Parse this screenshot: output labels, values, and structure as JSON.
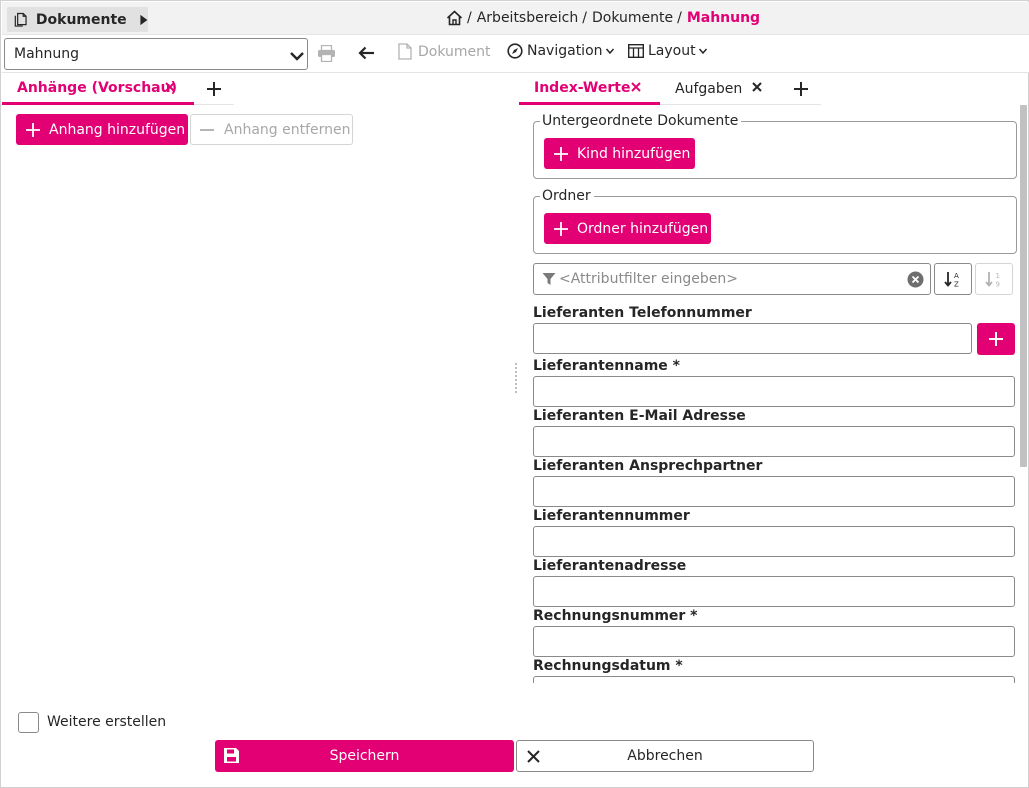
{
  "titlebar": {
    "module_label": "Dokumente",
    "breadcrumb": {
      "sep": "/",
      "items": [
        "Arbeitsbereich",
        "Dokumente"
      ],
      "current": "Mahnung"
    }
  },
  "toolbar": {
    "doctype_value": "Mahnung",
    "document_label": "Dokument",
    "navigation_label": "Navigation",
    "layout_label": "Layout"
  },
  "left_pane": {
    "tab_label": "Anhänge (Vorschau)",
    "add_attachment_label": "Anhang hinzufügen",
    "remove_attachment_label": "Anhang entfernen"
  },
  "right_pane": {
    "tabs": [
      {
        "label": "Index-Werte",
        "active": true
      },
      {
        "label": "Aufgaben",
        "active": false
      }
    ],
    "child_docs": {
      "legend": "Untergeordnete Dokumente",
      "button_label": "Kind hinzufügen"
    },
    "folders": {
      "legend": "Ordner",
      "button_label": "Ordner hinzufügen"
    },
    "filter_placeholder": "<Attributfilter eingeben>",
    "fields": [
      {
        "label": "Lieferanten Telefonnummer",
        "value": ""
      },
      {
        "label": "Lieferantenname *",
        "value": ""
      },
      {
        "label": "Lieferanten E-Mail Adresse",
        "value": ""
      },
      {
        "label": "Lieferanten Ansprechpartner",
        "value": ""
      },
      {
        "label": "Lieferantennummer",
        "value": ""
      },
      {
        "label": "Lieferantenadresse",
        "value": ""
      },
      {
        "label": "Rechnungsnummer *",
        "value": ""
      },
      {
        "label": "Rechnungsdatum *",
        "value": ""
      }
    ]
  },
  "footer": {
    "create_more_label": "Weitere erstellen",
    "create_more_checked": false,
    "save_label": "Speichern",
    "cancel_label": "Abbrechen"
  },
  "colors": {
    "accent": "#e20074",
    "text": "#262626",
    "disabled": "#a7a7a7",
    "border": "#8a8a8a"
  },
  "icons": {
    "documents": "documents-icon",
    "play_arrow": "play-arrow-icon",
    "home": "home-icon",
    "chevron": "chevron-down-icon",
    "print": "print-icon",
    "back": "arrow-left-icon",
    "document": "document-icon",
    "compass": "compass-icon",
    "layout": "layout-columns-icon",
    "close": "close-icon",
    "plus": "plus-icon",
    "minus": "minus-icon",
    "filter": "filter-icon",
    "clear": "clear-circle-icon",
    "sort_alpha": "sort-alpha-icon",
    "sort_numeric": "sort-numeric-icon",
    "save": "floppy-disk-icon"
  }
}
